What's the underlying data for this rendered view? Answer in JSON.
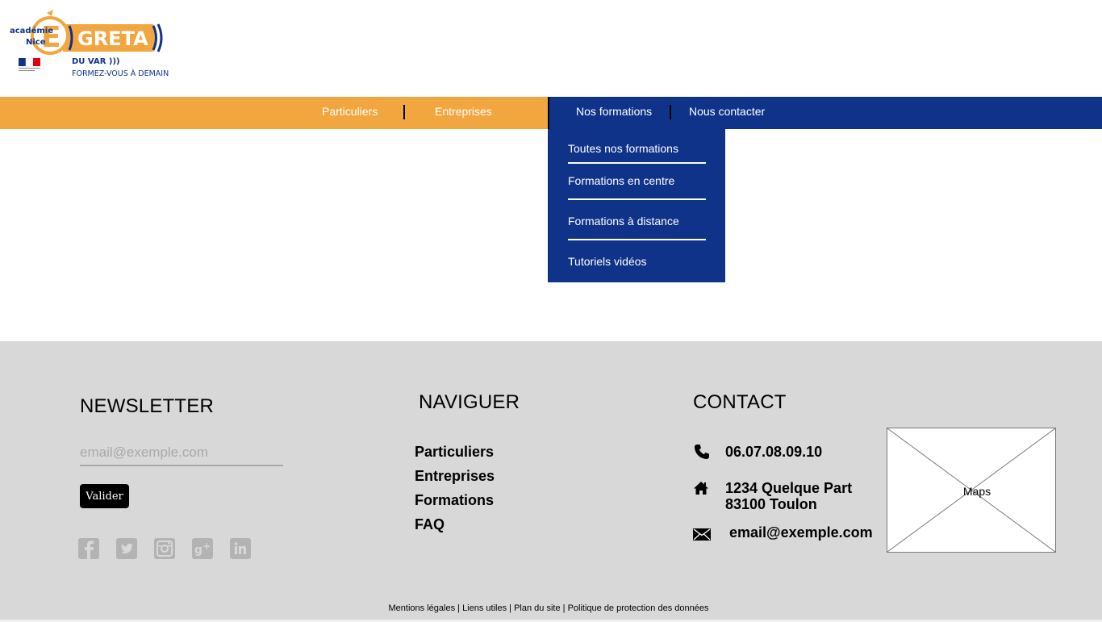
{
  "logo": {
    "academie_line1": "académie",
    "academie_line2": "Nice",
    "brand": "GRETA",
    "subtitle": "DU VAR )))",
    "tagline": "FORMEZ-VOUS À DEMAIN"
  },
  "nav": {
    "particuliers": "Particuliers",
    "entreprises": "Entreprises",
    "nos_formations": "Nos formations",
    "nous_contacter": "Nous contacter"
  },
  "dropdown": {
    "items": [
      "Toutes nos formations",
      "Formations en centre",
      "Formations à distance",
      "Tutoriels vidéos"
    ]
  },
  "footer": {
    "newsletter": {
      "title": "NEWSLETTER",
      "placeholder": "email@exemple.com",
      "button": "Valider"
    },
    "social_icons": [
      "facebook-icon",
      "twitter-icon",
      "instagram-icon",
      "google-plus-icon",
      "linkedin-icon"
    ],
    "naviguer": {
      "title": "NAVIGUER",
      "links": [
        "Particuliers",
        "Entreprises",
        "Formations",
        "FAQ"
      ]
    },
    "contact": {
      "title": "CONTACT",
      "phone": "06.07.08.09.10",
      "address_line1": "1234 Quelque Part",
      "address_line2": "83100 Toulon",
      "email": "email@exemple.com",
      "map_label": "Maps"
    },
    "legal": {
      "mentions": "Mentions légales",
      "liens": "Liens utiles",
      "plan": "Plan du site",
      "politique": "Politique de protection des données",
      "separator": " | "
    }
  },
  "colors": {
    "orange": "#f2a63f",
    "navy": "#10338a",
    "footer_bg": "#d8d8d8"
  }
}
